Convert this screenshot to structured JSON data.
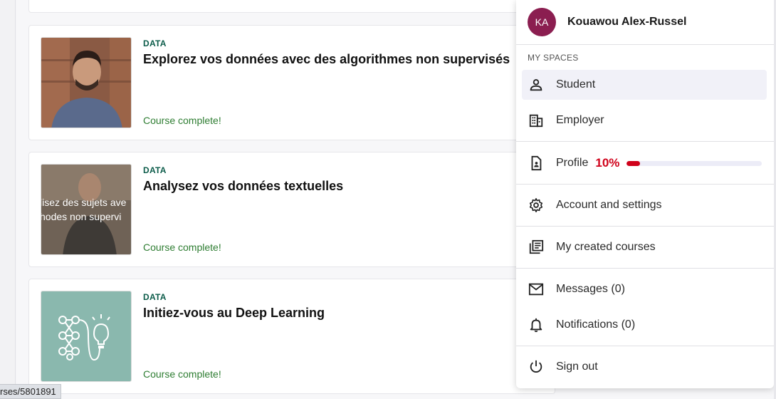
{
  "courses": [
    {
      "category": "DATA",
      "title": "Explorez vos données avec des algorithmes non supervisés",
      "status": "Course complete!"
    },
    {
      "category": "DATA",
      "title": "Analysez vos données textuelles",
      "status": "Course complete!",
      "thumb_overlay": [
        "lisez des sujets ave",
        "hodes non supervi"
      ]
    },
    {
      "category": "DATA",
      "title": "Initiez-vous au Deep Learning",
      "status": "Course complete!"
    }
  ],
  "status_url": "rses/5801891",
  "menu": {
    "user": {
      "initials": "KA",
      "name": "Kouawou Alex-Russel"
    },
    "section_title": "MY SPACES",
    "spaces": [
      {
        "label": "Student",
        "icon": "person-icon",
        "active": true
      },
      {
        "label": "Employer",
        "icon": "building-icon",
        "active": false
      }
    ],
    "profile": {
      "label": "Profile",
      "percent_text": "10%",
      "percent": 10
    },
    "account": {
      "label": "Account and settings",
      "icon": "gear-icon"
    },
    "created": {
      "label": "My created courses",
      "icon": "library-icon"
    },
    "messages": {
      "label": "Messages (0)",
      "icon": "mail-icon"
    },
    "notifications": {
      "label": "Notifications (0)",
      "icon": "bell-icon"
    },
    "signout": {
      "label": "Sign out",
      "icon": "power-icon"
    }
  },
  "colors": {
    "accent": "#d0021b",
    "avatar": "#8b1e50",
    "category": "#0c5c4a",
    "status": "#2e7d32"
  }
}
